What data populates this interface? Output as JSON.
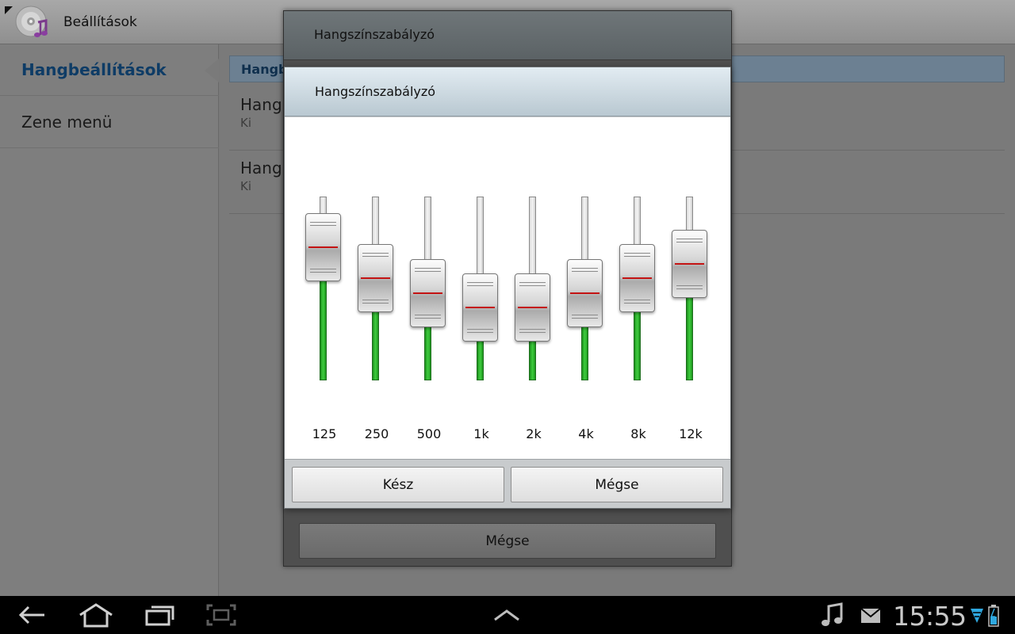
{
  "app": {
    "title": "Beállítások"
  },
  "sidebar": {
    "items": [
      {
        "label": "Hangbeállítások",
        "selected": true
      },
      {
        "label": "Zene menü",
        "selected": false
      }
    ]
  },
  "main": {
    "section_header": "Hangb",
    "rows": [
      {
        "title": "Hang",
        "subtitle": "Ki"
      },
      {
        "title": "Hang",
        "subtitle": "Ki"
      }
    ]
  },
  "outer_dialog": {
    "title": "Hangszínszabályzó",
    "cancel_label": "Mégse"
  },
  "eq_dialog": {
    "title": "Hangszínszabályzó",
    "bands": [
      {
        "label": "125",
        "level": 0.82
      },
      {
        "label": "250",
        "level": 0.65
      },
      {
        "label": "500",
        "level": 0.57
      },
      {
        "label": "1k",
        "level": 0.49
      },
      {
        "label": "2k",
        "level": 0.49
      },
      {
        "label": "4k",
        "level": 0.57
      },
      {
        "label": "8k",
        "level": 0.65
      },
      {
        "label": "12k",
        "level": 0.73
      }
    ],
    "done_label": "Kész",
    "cancel_label": "Mégse"
  },
  "system_bar": {
    "clock": "15:55",
    "icons": [
      "back-icon",
      "home-icon",
      "recent-apps-icon",
      "screenshot-icon",
      "up-arrow-icon",
      "music-note-icon",
      "mail-icon",
      "wifi-icon",
      "battery-icon"
    ]
  },
  "colors": {
    "accent_blue": "#0e3c66",
    "slider_green": "#2fb52f",
    "slider_red_line": "#c41414"
  }
}
